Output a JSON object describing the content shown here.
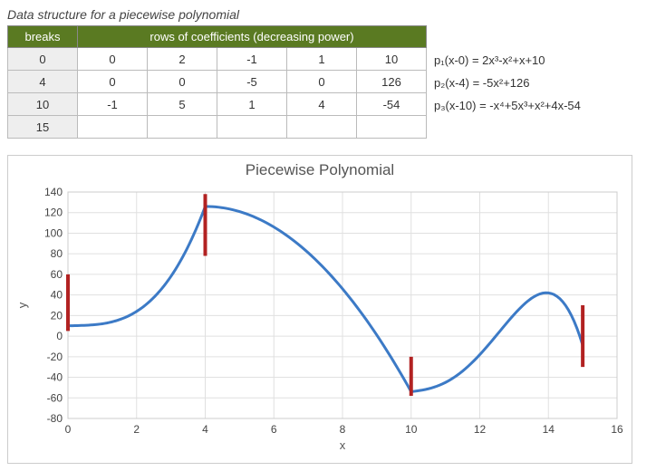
{
  "title": "Data structure for a piecewise polynomial",
  "table": {
    "breaks_header": "breaks",
    "coeff_header": "rows of coefficients (decreasing power)",
    "rows": [
      {
        "break": "0",
        "c": [
          "0",
          "2",
          "-1",
          "1",
          "10"
        ]
      },
      {
        "break": "4",
        "c": [
          "0",
          "0",
          "-5",
          "0",
          "126"
        ]
      },
      {
        "break": "10",
        "c": [
          "-1",
          "5",
          "1",
          "4",
          "-54"
        ]
      },
      {
        "break": "15",
        "c": [
          "",
          "",
          "",
          "",
          ""
        ]
      }
    ]
  },
  "formulas": {
    "p1": "p₁(x-0) = 2x³-x²+x+10",
    "p2": "p₂(x-4) = -5x²+126",
    "p3": "p₃(x-10) = -x⁴+5x³+x²+4x-54"
  },
  "chart_data": {
    "type": "line",
    "title": "Piecewise Polynomial",
    "xlabel": "x",
    "ylabel": "y",
    "xlim": [
      0,
      16
    ],
    "ylim": [
      -80,
      140
    ],
    "xticks": [
      0,
      2,
      4,
      6,
      8,
      10,
      12,
      14,
      16
    ],
    "yticks": [
      -80,
      -60,
      -40,
      -20,
      0,
      20,
      40,
      60,
      80,
      100,
      120,
      140
    ],
    "pieces": [
      {
        "x0": 0,
        "x1": 4,
        "coeffs": [
          0,
          2,
          -1,
          1,
          10
        ],
        "shift": 0
      },
      {
        "x0": 4,
        "x1": 10,
        "coeffs": [
          0,
          0,
          -5,
          0,
          126
        ],
        "shift": 4
      },
      {
        "x0": 10,
        "x1": 15,
        "coeffs": [
          -1,
          5,
          1,
          4,
          -54
        ],
        "shift": 10
      }
    ],
    "break_markers": [
      {
        "x": 0,
        "y0": 5,
        "y1": 60
      },
      {
        "x": 4,
        "y0": 78,
        "y1": 138
      },
      {
        "x": 10,
        "y0": -58,
        "y1": -20
      },
      {
        "x": 15,
        "y0": -30,
        "y1": 30
      }
    ]
  }
}
